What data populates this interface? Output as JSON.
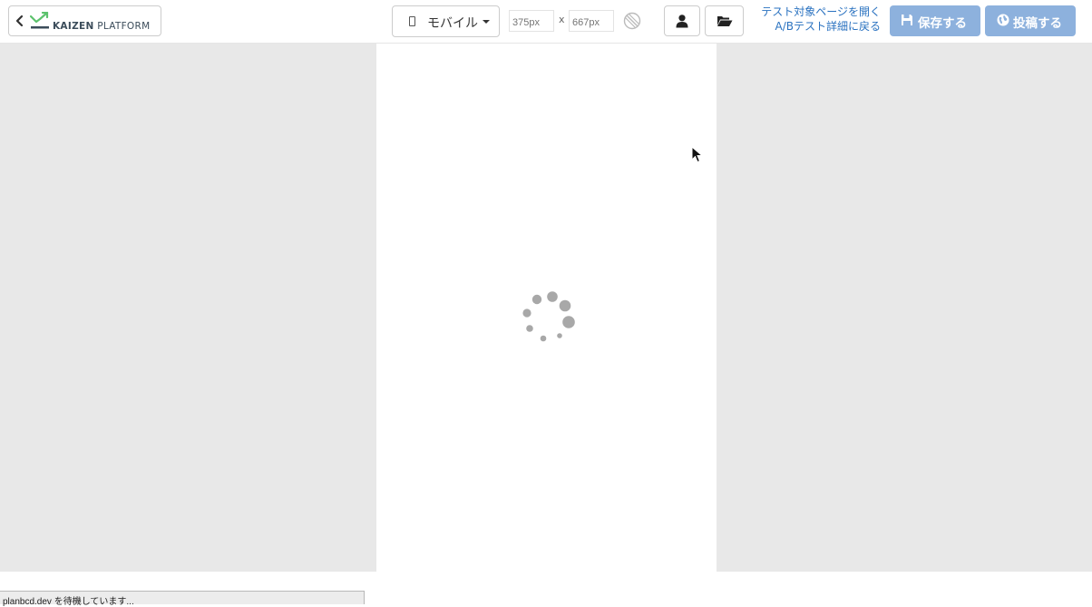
{
  "toolbar": {
    "logo": {
      "brand_bold": "KAIZEN",
      "brand_light": "PLATFORM"
    },
    "device": {
      "selected": "モバイル"
    },
    "width_input": {
      "value": "",
      "placeholder": "375px"
    },
    "height_input": {
      "value": "",
      "placeholder": "667px"
    },
    "dim_separator": "x",
    "links": {
      "open_target": "テスト対象ページを開く",
      "back_to_ab": "A/Bテスト詳細に戻る"
    },
    "save_label": "保存する",
    "publish_label": "投稿する"
  },
  "status": {
    "text": "planbcd.dev を待機しています..."
  },
  "colors": {
    "toolbar_bg": "#ffffff",
    "stage_bg": "#e8e8e8",
    "primary_button": "#8db1dd",
    "link": "#2a72c0",
    "logo_green": "#5cc26d",
    "spinner_gray": "#a8a8a8"
  },
  "icons": {
    "back": "chevron-left-icon",
    "logo": "kaizen-chart-icon",
    "device": "mobile-phone-icon",
    "rotate": "rotate-icon",
    "user": "user-icon",
    "folder": "folder-open-icon",
    "save": "floppy-disk-icon",
    "publish": "globe-icon",
    "loading": "loading-spinner-icon",
    "cursor": "mouse-cursor-icon"
  }
}
